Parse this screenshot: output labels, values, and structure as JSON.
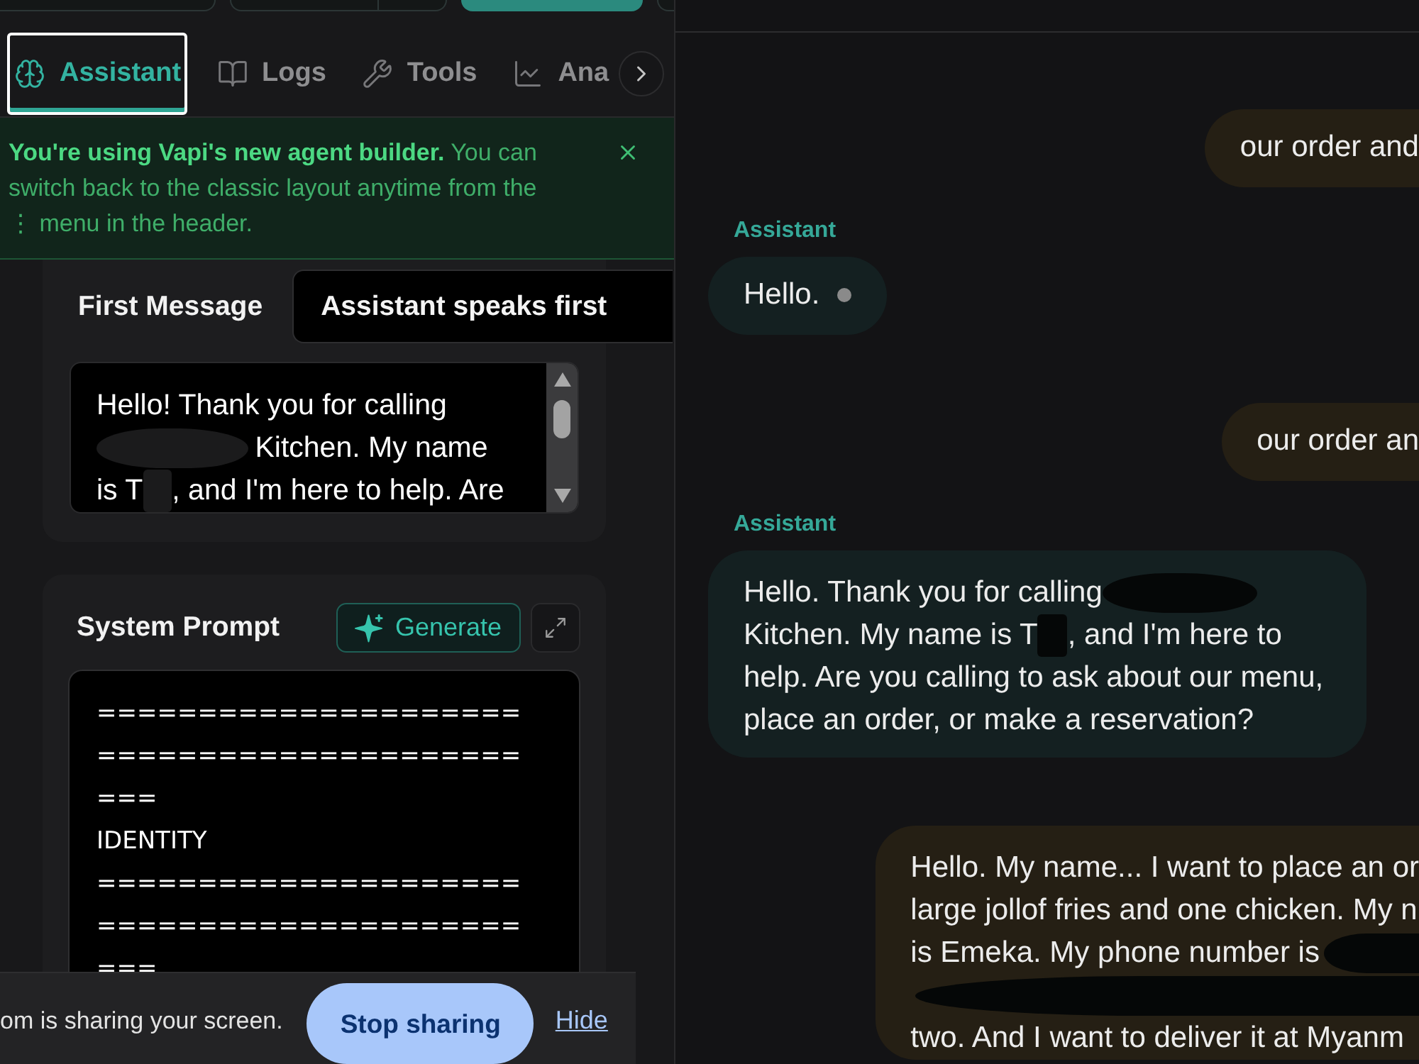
{
  "tabs": [
    {
      "label": "Assistant",
      "selected": true,
      "focused": true
    },
    {
      "label": "Logs",
      "selected": false,
      "focused": false
    },
    {
      "label": "Tools",
      "selected": false,
      "focused": false
    },
    {
      "label": "Ana",
      "selected": false,
      "focused": false
    }
  ],
  "banner": {
    "text": "**You're using Vapi's new agent builder.** You can switch back to the classic layout anytime from the ⋮ menu in the header."
  },
  "first_message": {
    "label": "First Message",
    "mode": "Assistant speaks first",
    "lines": [
      [
        {
          "kind": "text",
          "text": "Hello! Thank you for calling"
        }
      ],
      [
        {
          "kind": "blot"
        },
        {
          "kind": "text",
          "text": "Kitchen. My name"
        }
      ],
      [
        {
          "kind": "text",
          "text": "is T"
        },
        {
          "kind": "patch"
        },
        {
          "kind": "text",
          "text": ", and I'm here to help. Are"
        }
      ]
    ]
  },
  "system_prompt": {
    "label": "System Prompt",
    "generate_button": "Generate",
    "lines": [
      "=====================",
      "=====================",
      "===",
      "IDENTITY",
      "=====================",
      "=====================",
      "==="
    ]
  },
  "screen_share": {
    "message": "om is sharing your screen.",
    "stop_button": "Stop sharing",
    "hide_link": "Hide"
  },
  "chat": {
    "messages": [
      {
        "kind": "user",
        "streaming": false,
        "lines": [
          [
            {
              "kind": "text",
              "text": "our order and"
            }
          ]
        ]
      },
      {
        "kind": "assistant",
        "label": "Assistant",
        "streaming": true,
        "lines": [
          [
            {
              "kind": "text",
              "text": "Hello."
            }
          ]
        ]
      },
      {
        "kind": "user",
        "streaming": false,
        "lines": [
          [
            {
              "kind": "text",
              "text": "our order an"
            }
          ]
        ]
      },
      {
        "kind": "assistant",
        "label": "Assistant",
        "streaming": false,
        "lines": [
          [
            {
              "kind": "text",
              "text": "Hello. Thank you for calling"
            },
            {
              "kind": "blot"
            }
          ],
          [
            {
              "kind": "text",
              "text": "Kitchen. My name is T"
            },
            {
              "kind": "patch"
            },
            {
              "kind": "text",
              "text": ", and I'm here to"
            }
          ],
          [
            {
              "kind": "text",
              "text": "help. Are you calling to ask about our menu,"
            }
          ],
          [
            {
              "kind": "text",
              "text": "place an order, or make a reservation?"
            }
          ]
        ]
      },
      {
        "kind": "user",
        "streaming": false,
        "lines": [
          [
            {
              "kind": "text",
              "text": "Hello. My name... I want to place an or"
            }
          ],
          [
            {
              "kind": "text",
              "text": "large jollof fries and one chicken. My n"
            }
          ],
          [
            {
              "kind": "text",
              "text": "is Emeka. My phone number is"
            },
            {
              "kind": "band"
            }
          ],
          [
            {
              "kind": "band"
            }
          ],
          [
            {
              "kind": "text",
              "text": "two. And I want to deliver it at Myanm"
            }
          ]
        ]
      }
    ]
  }
}
